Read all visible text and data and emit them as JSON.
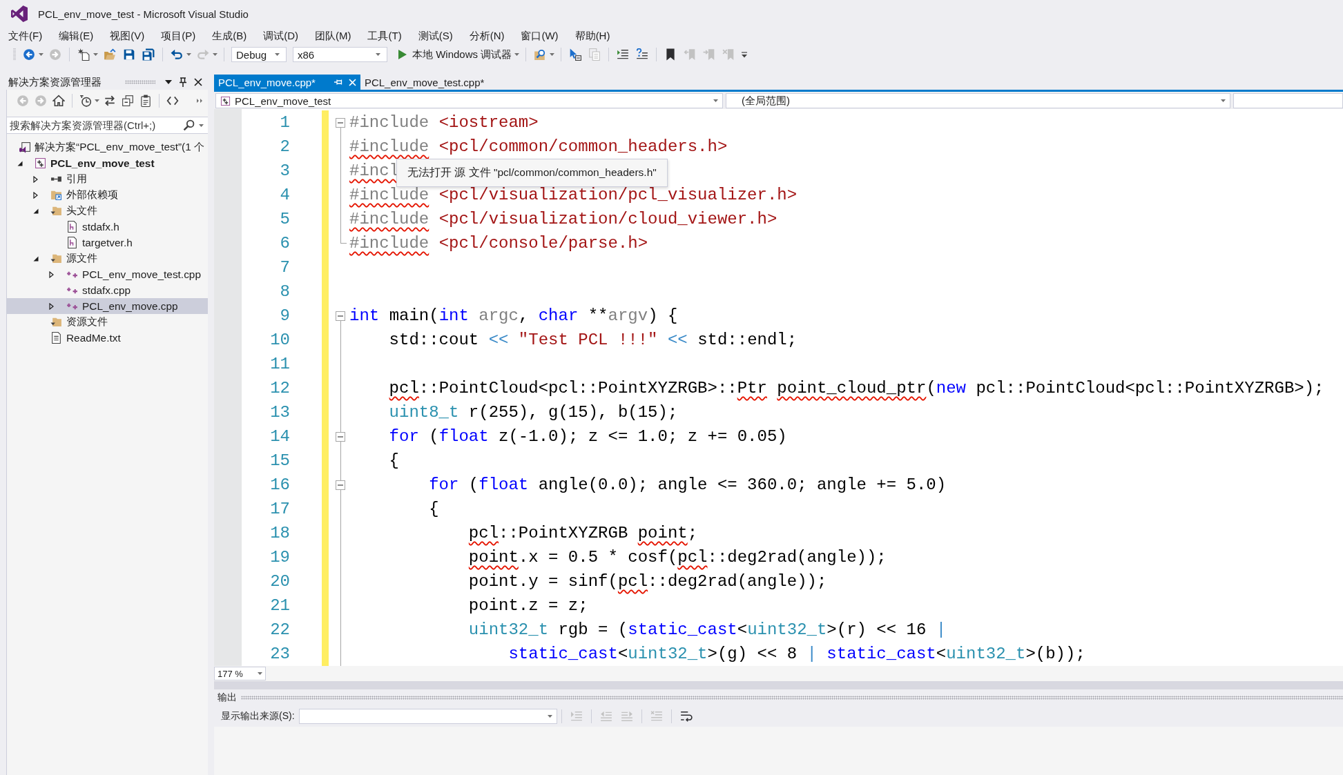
{
  "window": {
    "title": "PCL_env_move_test - Microsoft Visual Studio"
  },
  "menu": [
    "文件(F)",
    "编辑(E)",
    "视图(V)",
    "项目(P)",
    "生成(B)",
    "调试(D)",
    "团队(M)",
    "工具(T)",
    "测试(S)",
    "分析(N)",
    "窗口(W)",
    "帮助(H)"
  ],
  "toolbar": [
    {
      "kind": "split",
      "disabled": false
    },
    {
      "kind": "button",
      "disabled": true
    },
    {
      "kind": "split",
      "disabled": false
    },
    {
      "kind": "button",
      "disabled": false
    },
    {
      "kind": "button",
      "disabled": false
    },
    {
      "kind": "button",
      "disabled": false
    },
    {
      "kind": "split",
      "disabled": false
    },
    {
      "kind": "split",
      "disabled": true
    },
    {
      "kind": "combo",
      "value": "Debug"
    },
    {
      "kind": "combo",
      "value": "x86"
    },
    {
      "kind": "run",
      "label": "本地 Windows 调试器"
    },
    {
      "kind": "split",
      "disabled": false
    },
    {
      "kind": "button",
      "disabled": false
    },
    {
      "kind": "button",
      "disabled": true
    },
    {
      "kind": "button",
      "disabled": false
    },
    {
      "kind": "button",
      "disabled": false
    },
    {
      "kind": "button",
      "disabled": false
    },
    {
      "kind": "button",
      "disabled": true
    },
    {
      "kind": "button",
      "disabled": true
    },
    {
      "kind": "button",
      "disabled": true
    }
  ],
  "solution_explorer": {
    "title": "解决方案资源管理器",
    "toolbar": [
      {
        "kind": "button",
        "disabled": true
      },
      {
        "kind": "button",
        "disabled": true
      },
      {
        "kind": "button",
        "disabled": false
      },
      {
        "kind": "split",
        "disabled": false
      },
      {
        "kind": "button",
        "disabled": false
      },
      {
        "kind": "button",
        "disabled": false
      },
      {
        "kind": "button",
        "disabled": false
      },
      {
        "kind": "button",
        "disabled": false
      }
    ],
    "search": {
      "placeholder": "搜索解决方案资源管理器(Ctrl+;)"
    },
    "tree": [
      {
        "label": "解决方案“PCL_env_move_test”(1 个",
        "kind": "solution",
        "selected": false,
        "children": [
          {
            "label": "PCL_env_move_test",
            "kind": "project",
            "expanded": true,
            "selected": false,
            "children": [
              {
                "label": "引用",
                "kind": "references",
                "expanded": false,
                "selected": false
              },
              {
                "label": "外部依赖项",
                "kind": "external",
                "expanded": false,
                "selected": false
              },
              {
                "label": "头文件",
                "kind": "filter",
                "expanded": true,
                "selected": false,
                "children": [
                  {
                    "label": "stdafx.h",
                    "kind": "header",
                    "selected": false
                  },
                  {
                    "label": "targetver.h",
                    "kind": "header",
                    "selected": false
                  }
                ]
              },
              {
                "label": "源文件",
                "kind": "filter",
                "expanded": true,
                "selected": false,
                "children": [
                  {
                    "label": "PCL_env_move_test.cpp",
                    "kind": "source",
                    "expanded": false,
                    "selected": false
                  },
                  {
                    "label": "stdafx.cpp",
                    "kind": "source",
                    "selected": false
                  },
                  {
                    "label": "PCL_env_move.cpp",
                    "kind": "source",
                    "expanded": false,
                    "selected": true
                  }
                ]
              },
              {
                "label": "资源文件",
                "kind": "filter",
                "selected": false
              },
              {
                "label": "ReadMe.txt",
                "kind": "text",
                "selected": false
              }
            ]
          }
        ]
      }
    ]
  },
  "editor": {
    "tabs": [
      {
        "label": "PCL_env_move.cpp*",
        "selected": true
      },
      {
        "label": "PCL_env_move_test.cpp*",
        "selected": false
      }
    ],
    "navigation": {
      "project": "PCL_env_move_test",
      "scope": "(全局范围)"
    },
    "lines": [
      {
        "number": "1",
        "modified": true,
        "kind": "collapse",
        "tokens": [
          {
            "text": "#include",
            "kind": "pp",
            "error": false
          },
          {
            "text": " <iostream>",
            "kind": "str",
            "error": false
          }
        ]
      },
      {
        "number": "2",
        "modified": true,
        "kind": "guide",
        "tokens": [
          {
            "text": "#include",
            "kind": "pp",
            "error": true
          },
          {
            "text": " <pcl/common/common_headers.h>",
            "kind": "str",
            "error": false
          }
        ]
      },
      {
        "number": "3",
        "modified": true,
        "kind": "guide",
        "tokens": [
          {
            "text": "#incl",
            "kind": "pp",
            "error": true
          }
        ]
      },
      {
        "number": "4",
        "modified": true,
        "kind": "guide",
        "tokens": [
          {
            "text": "#include",
            "kind": "pp",
            "error": true
          },
          {
            "text": " <pcl/visualization/pcl_visualizer.h>",
            "kind": "str",
            "error": false
          }
        ]
      },
      {
        "number": "5",
        "modified": true,
        "kind": "guide",
        "tokens": [
          {
            "text": "#include",
            "kind": "pp",
            "error": true
          },
          {
            "text": " <pcl/visualization/cloud_viewer.h>",
            "kind": "str",
            "error": false
          }
        ]
      },
      {
        "number": "6",
        "modified": true,
        "kind": "end",
        "tokens": [
          {
            "text": "#include",
            "kind": "pp",
            "error": true
          },
          {
            "text": " <pcl/console/parse.h>",
            "kind": "str",
            "error": false
          }
        ]
      },
      {
        "number": "7",
        "modified": true,
        "kind": "none"
      },
      {
        "number": "8",
        "modified": true,
        "kind": "none"
      },
      {
        "number": "9",
        "modified": true,
        "kind": "collapse",
        "tokens": [
          {
            "text": "int",
            "kind": "kw",
            "error": false
          },
          {
            "text": " main(",
            "kind": "plain",
            "error": false
          },
          {
            "text": "int",
            "kind": "kw",
            "error": false
          },
          {
            "text": " argc",
            "kind": "param",
            "error": false
          },
          {
            "text": ",",
            "kind": "plain",
            "error": false
          },
          {
            "text": " char",
            "kind": "kw",
            "error": false
          },
          {
            "text": " **",
            "kind": "plain",
            "error": false
          },
          {
            "text": "argv",
            "kind": "param",
            "error": false
          },
          {
            "text": ") {",
            "kind": "plain",
            "error": false
          }
        ]
      },
      {
        "number": "10",
        "modified": true,
        "kind": "guide",
        "tokens": [
          {
            "text": "    std::cout",
            "kind": "plain",
            "error": false
          },
          {
            "text": " <<",
            "kind": "op",
            "error": false
          },
          {
            "text": " \"Test PCL !!!\"",
            "kind": "str",
            "error": false
          },
          {
            "text": " <<",
            "kind": "op",
            "error": false
          },
          {
            "text": " std::endl;",
            "kind": "plain",
            "error": false
          }
        ]
      },
      {
        "number": "11",
        "modified": true,
        "kind": "guide"
      },
      {
        "number": "12",
        "modified": true,
        "kind": "guide",
        "tokens": [
          {
            "text": "    pcl",
            "kind": "plain",
            "error": true
          },
          {
            "text": "::PointCloud<pcl::PointXYZRGB>::",
            "kind": "plain",
            "error": false
          },
          {
            "text": "Ptr",
            "kind": "plain",
            "error": true
          },
          {
            "text": " point_cloud_ptr",
            "kind": "plain",
            "error": true
          },
          {
            "text": "(",
            "kind": "plain",
            "error": false
          },
          {
            "text": "new",
            "kind": "kw",
            "error": false
          },
          {
            "text": " pcl::PointCloud<pcl::PointXYZRGB>);",
            "kind": "plain",
            "error": false
          }
        ]
      },
      {
        "number": "13",
        "modified": true,
        "kind": "guide",
        "tokens": [
          {
            "text": "    uint8_t",
            "kind": "type",
            "error": false
          },
          {
            "text": " r(255), g(15), b(15);",
            "kind": "plain",
            "error": false
          }
        ]
      },
      {
        "number": "14",
        "modified": true,
        "kind": "collapse",
        "tokens": [
          {
            "text": "    for",
            "kind": "kw",
            "error": false
          },
          {
            "text": " (",
            "kind": "plain",
            "error": false
          },
          {
            "text": "float",
            "kind": "kw",
            "error": false
          },
          {
            "text": " z(-1.0); z <= 1.0; z += 0.05)",
            "kind": "plain",
            "error": false
          }
        ]
      },
      {
        "number": "15",
        "modified": true,
        "kind": "guide",
        "tokens": [
          {
            "text": "    {",
            "kind": "plain",
            "error": false
          }
        ]
      },
      {
        "number": "16",
        "modified": true,
        "kind": "collapse",
        "tokens": [
          {
            "text": "        for",
            "kind": "kw",
            "error": false
          },
          {
            "text": " (",
            "kind": "plain",
            "error": false
          },
          {
            "text": "float",
            "kind": "kw",
            "error": false
          },
          {
            "text": " angle(0.0); angle <= 360.0; angle += 5.0)",
            "kind": "plain",
            "error": false
          }
        ]
      },
      {
        "number": "17",
        "modified": true,
        "kind": "guide",
        "tokens": [
          {
            "text": "        {",
            "kind": "plain",
            "error": false
          }
        ]
      },
      {
        "number": "18",
        "modified": true,
        "kind": "guide",
        "tokens": [
          {
            "text": "            pcl",
            "kind": "plain",
            "error": true
          },
          {
            "text": "::PointXYZRGB",
            "kind": "plain",
            "error": false
          },
          {
            "text": " point",
            "kind": "plain",
            "error": true
          },
          {
            "text": ";",
            "kind": "plain",
            "error": false
          }
        ]
      },
      {
        "number": "19",
        "modified": true,
        "kind": "guide",
        "tokens": [
          {
            "text": "            point",
            "kind": "plain",
            "error": true
          },
          {
            "text": ".x = 0.5 * cosf(",
            "kind": "plain",
            "error": false
          },
          {
            "text": "pcl",
            "kind": "plain",
            "error": true
          },
          {
            "text": "::deg2rad(angle));",
            "kind": "plain",
            "error": false
          }
        ]
      },
      {
        "number": "20",
        "modified": true,
        "kind": "guide",
        "tokens": [
          {
            "text": "            point.y = sinf(",
            "kind": "plain",
            "error": false
          },
          {
            "text": "pcl",
            "kind": "plain",
            "error": true
          },
          {
            "text": "::deg2rad(angle));",
            "kind": "plain",
            "error": false
          }
        ]
      },
      {
        "number": "21",
        "modified": true,
        "kind": "guide",
        "tokens": [
          {
            "text": "            point.z = z;",
            "kind": "plain",
            "error": false
          }
        ]
      },
      {
        "number": "22",
        "modified": true,
        "kind": "guide",
        "tokens": [
          {
            "text": "            uint32_t",
            "kind": "type",
            "error": false
          },
          {
            "text": " rgb = (",
            "kind": "plain",
            "error": false
          },
          {
            "text": "static_cast",
            "kind": "kw",
            "error": false
          },
          {
            "text": "<",
            "kind": "plain",
            "error": false
          },
          {
            "text": "uint32_t",
            "kind": "type",
            "error": false
          },
          {
            "text": ">(r) << 16",
            "kind": "plain",
            "error": false
          },
          {
            "text": " |",
            "kind": "op",
            "error": false
          }
        ]
      },
      {
        "number": "23",
        "modified": true,
        "kind": "guide",
        "tokens": [
          {
            "text": "                static_cast",
            "kind": "kw",
            "error": false
          },
          {
            "text": "<",
            "kind": "plain",
            "error": false
          },
          {
            "text": "uint32_t",
            "kind": "type",
            "error": false
          },
          {
            "text": ">(g) << 8",
            "kind": "plain",
            "error": false
          },
          {
            "text": " |",
            "kind": "op",
            "error": false
          },
          {
            "text": " static_cast",
            "kind": "kw",
            "error": false
          },
          {
            "text": "<",
            "kind": "plain",
            "error": false
          },
          {
            "text": "uint32_t",
            "kind": "type",
            "error": false
          },
          {
            "text": ">(b));",
            "kind": "plain",
            "error": false
          }
        ]
      }
    ],
    "tooltip": "无法打开 源 文件 \"pcl/common/common_headers.h\"",
    "zoom": "177 %"
  },
  "output": {
    "title": "输出",
    "source_label": "显示输出来源(S):",
    "toolbar": [
      {
        "disabled": true
      },
      {
        "disabled": true
      },
      {
        "disabled": true
      },
      {
        "disabled": true
      },
      {
        "disabled": false
      }
    ]
  }
}
